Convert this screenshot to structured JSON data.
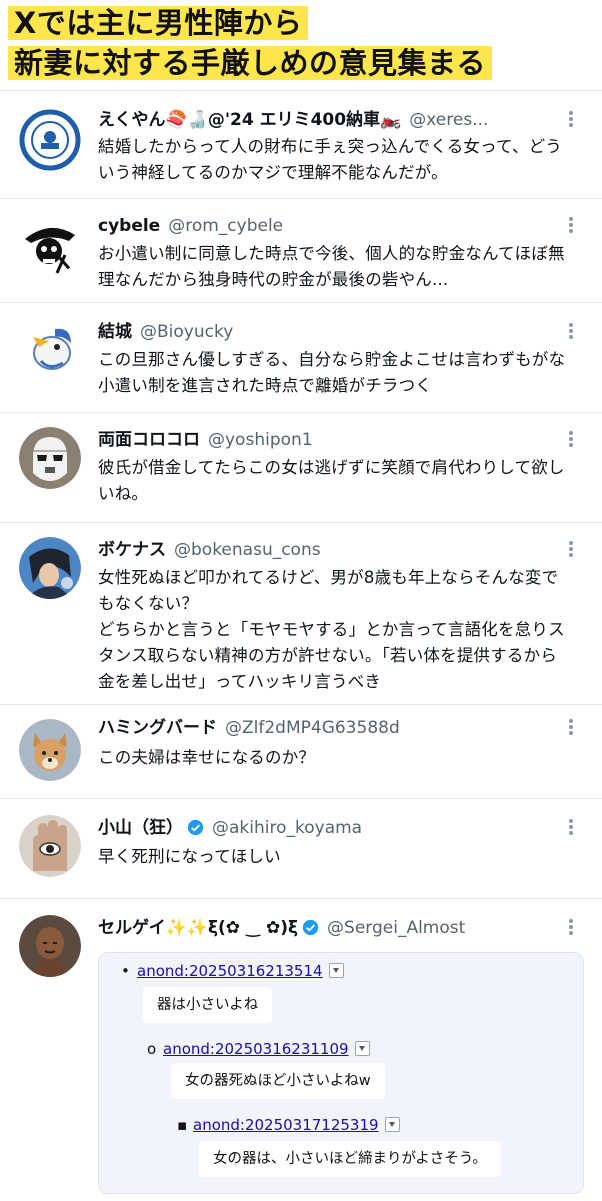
{
  "banner": {
    "line1": "Xでは主に男性陣から",
    "line2": "新妻に対する手厳しめの意見集まる"
  },
  "posts": [
    {
      "name": "えくやん🍣🍶@'24 エリミ400納車🏍️",
      "handle": "@xeres...",
      "avatar_icon": "robot-emblem-avatar",
      "text": [
        "結婚したからって人の財布に手ぇ突っ込んでくる女って、どう",
        "いう神経してるのかマジで理解不能なんだが。"
      ]
    },
    {
      "name": "cybele",
      "handle": "@rom_cybele",
      "avatar_icon": "pirate-skull-avatar",
      "text": [
        "お小遣い制に同意した時点で今後、個人的な貯金なんてほぼ無",
        "理なんだから独身時代の貯金が最後の砦やん..."
      ]
    },
    {
      "name": "結城",
      "handle": "@Bioyucky",
      "avatar_icon": "bird-character-avatar",
      "text": [
        "この旦那さん優しすぎる、自分なら貯金よこせは言わずもがな",
        "小遣い制を進言された時点で離婚がチラつく"
      ]
    },
    {
      "name": "両面コロコロ",
      "handle": "@yoshipon1",
      "avatar_icon": "stormtrooper-helmet-avatar",
      "text": [
        "彼氏が借金してたらこの女は逃げずに笑顔で肩代わりして欲し",
        "いね。"
      ]
    },
    {
      "name": "ボケナス",
      "handle": "@bokenasu_cons",
      "avatar_icon": "anime-character-avatar",
      "text": [
        "女性死ぬほど叩かれてるけど、男が8歳も年上ならそんな変で",
        "もなくない？",
        "どちらかと言うと「モヤモヤする」とか言って言語化を怠りス",
        "タンス取らない精神の方が許せない。「若い体を提供するから",
        "金を差し出せ」ってハッキリ言うべき"
      ]
    },
    {
      "name": "ハミングバード",
      "handle": "@Zlf2dMP4G63588d",
      "avatar_icon": "dog-avatar",
      "text": [
        "この夫婦は幸せになるのか？"
      ]
    },
    {
      "name": "小山（狂）",
      "handle": "@akihiro_koyama",
      "avatar_icon": "hand-eye-avatar",
      "verified": true,
      "text": [
        "早く死刑になってほしい"
      ]
    },
    {
      "name": "セルゲイ✨✨ξ(✿ ‿ ✿)ξ",
      "handle": "@Sergei_Almost",
      "avatar_icon": "bald-man-avatar",
      "verified": true,
      "text": []
    }
  ],
  "quote": {
    "entries": [
      {
        "bullet": "•",
        "link": "anond:20250316213514",
        "message": "器は小さいよね"
      },
      {
        "bullet": "o",
        "link": "anond:20250316231109",
        "message": "女の器死ぬほど小さいよねw"
      },
      {
        "bullet": "▪",
        "link": "anond:20250317125319",
        "message": "女の器は、小さいほど締まりがよさそう。"
      }
    ]
  },
  "colors": {
    "banner_highlight": "#ffe64d",
    "verified_badge": "#1d9bf0",
    "handle_gray": "#536471",
    "link_blue": "#1a0dab"
  }
}
